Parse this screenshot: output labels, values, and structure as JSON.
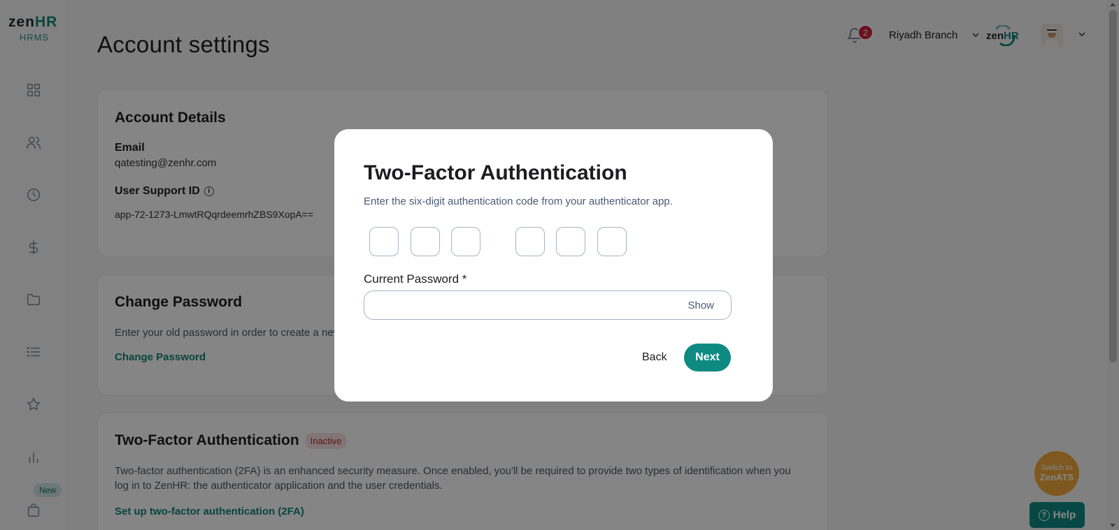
{
  "sidebar": {
    "logo_main": "zen",
    "logo_hr": "HR",
    "logo_sub": "HRMS",
    "icons": [
      "dashboard-icon",
      "people-icon",
      "clock-icon",
      "dollar-icon",
      "folder-icon",
      "list-icon",
      "star-icon",
      "chart-icon",
      "bag-icon"
    ],
    "new_badge": "New"
  },
  "header": {
    "title": "Account settings",
    "notification_count": "2",
    "branch": "Riyadh Branch",
    "mini_logo_main": "zen",
    "mini_logo_hr": "HR"
  },
  "account_details": {
    "title": "Account Details",
    "email_label": "Email",
    "email_value": "qatesting@zenhr.com",
    "support_id_label": "User Support ID",
    "support_id_value": "app-72-1273-LmwtRQqrdeemrhZBS9XopA=="
  },
  "change_password": {
    "title": "Change Password",
    "description": "Enter your old password in order to create a new password.",
    "link": "Change Password"
  },
  "two_factor": {
    "title": "Two-Factor Authentication",
    "status": "Inactive",
    "description": "Two-factor authentication (2FA) is an enhanced security measure. Once enabled, you'll be required to provide two types of identification when you log in to ZenHR: the authenticator application and the user credentials.",
    "link": "Set up two-factor authentication (2FA)"
  },
  "floating": {
    "switch_line1": "Switch to",
    "switch_line2": "ZenATS",
    "help": "Help"
  },
  "modal": {
    "title": "Two-Factor Authentication",
    "subtitle": "Enter the six-digit authentication code from your authenticator app.",
    "otp_values": [
      "",
      "",
      "",
      "",
      "",
      ""
    ],
    "password_label": "Current Password",
    "password_required": "*",
    "password_value": "",
    "show_label": "Show",
    "back_label": "Back",
    "next_label": "Next",
    "accent_color": "#0e8a83"
  }
}
